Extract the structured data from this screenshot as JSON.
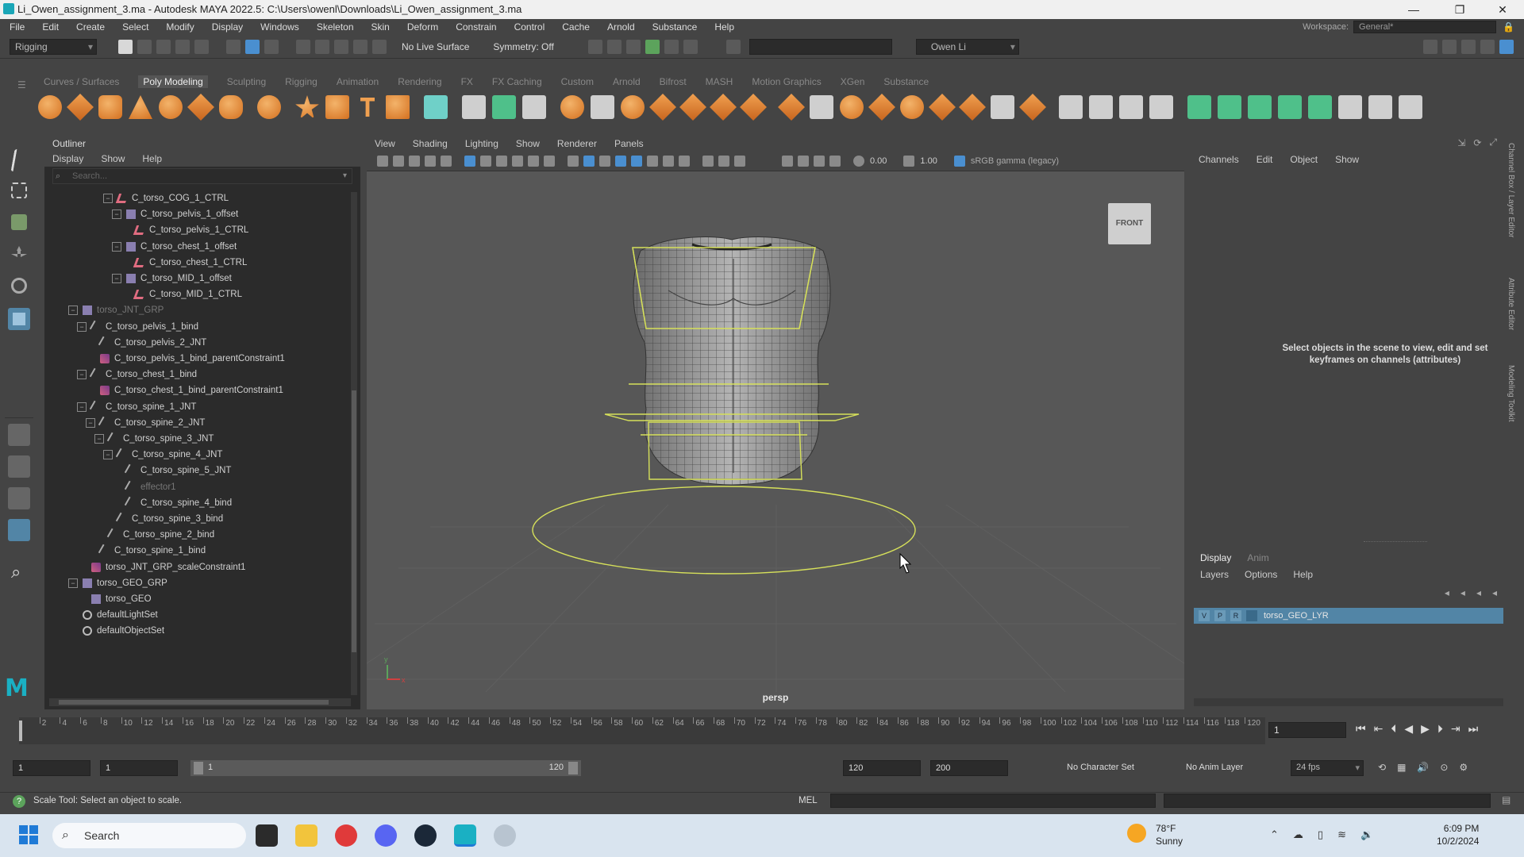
{
  "window": {
    "title": "Li_Owen_assignment_3.ma - Autodesk MAYA 2022.5: C:\\Users\\owenl\\Downloads\\Li_Owen_assignment_3.ma"
  },
  "menubar": {
    "items": [
      "File",
      "Edit",
      "Create",
      "Select",
      "Modify",
      "Display",
      "Windows",
      "Skeleton",
      "Skin",
      "Deform",
      "Constrain",
      "Control",
      "Cache",
      "Arnold",
      "Substance",
      "Help"
    ],
    "workspace_label": "Workspace:",
    "workspace_value": "General*"
  },
  "statusline": {
    "menuset": "Rigging",
    "live_surface": "No Live Surface",
    "symmetry": "Symmetry: Off",
    "user": "Owen Li"
  },
  "shelf": {
    "tabs": [
      "Curves / Surfaces",
      "Poly Modeling",
      "Sculpting",
      "Rigging",
      "Animation",
      "Rendering",
      "FX",
      "FX Caching",
      "Custom",
      "Arnold",
      "Bifrost",
      "MASH",
      "Motion Graphics",
      "XGen",
      "Substance"
    ],
    "active_tab": "Poly Modeling"
  },
  "outliner": {
    "title": "Outliner",
    "menu": [
      "Display",
      "Show",
      "Help"
    ],
    "search_placeholder": "Search...",
    "items": [
      {
        "label": "C_torso_COG_1_CTRL",
        "indent": 6,
        "icon": "ctrl",
        "toggle": "⊟"
      },
      {
        "label": "C_torso_pelvis_1_offset",
        "indent": 7,
        "icon": "grp",
        "toggle": "⊟"
      },
      {
        "label": "C_torso_pelvis_1_CTRL",
        "indent": 8,
        "icon": "ctrl",
        "toggle": ""
      },
      {
        "label": "C_torso_chest_1_offset",
        "indent": 7,
        "icon": "grp",
        "toggle": "⊟"
      },
      {
        "label": "C_torso_chest_1_CTRL",
        "indent": 8,
        "icon": "ctrl",
        "toggle": ""
      },
      {
        "label": "C_torso_MID_1_offset",
        "indent": 7,
        "icon": "grp",
        "toggle": "⊟"
      },
      {
        "label": "C_torso_MID_1_CTRL",
        "indent": 8,
        "icon": "ctrl",
        "toggle": ""
      },
      {
        "label": "torso_JNT_GRP",
        "indent": 2,
        "icon": "grp",
        "toggle": "⊟",
        "grey": true
      },
      {
        "label": "C_torso_pelvis_1_bind",
        "indent": 3,
        "icon": "jnt",
        "toggle": "⊟"
      },
      {
        "label": "C_torso_pelvis_2_JNT",
        "indent": 4,
        "icon": "jnt",
        "toggle": ""
      },
      {
        "label": "C_torso_pelvis_1_bind_parentConstraint1",
        "indent": 4,
        "icon": "con",
        "toggle": ""
      },
      {
        "label": "C_torso_chest_1_bind",
        "indent": 3,
        "icon": "jnt",
        "toggle": "⊟"
      },
      {
        "label": "C_torso_chest_1_bind_parentConstraint1",
        "indent": 4,
        "icon": "con",
        "toggle": ""
      },
      {
        "label": "C_torso_spine_1_JNT",
        "indent": 3,
        "icon": "jnt",
        "toggle": "⊟"
      },
      {
        "label": "C_torso_spine_2_JNT",
        "indent": 4,
        "icon": "jnt",
        "toggle": "⊟"
      },
      {
        "label": "C_torso_spine_3_JNT",
        "indent": 5,
        "icon": "jnt",
        "toggle": "⊟"
      },
      {
        "label": "C_torso_spine_4_JNT",
        "indent": 6,
        "icon": "jnt",
        "toggle": "⊟"
      },
      {
        "label": "C_torso_spine_5_JNT",
        "indent": 7,
        "icon": "jnt",
        "toggle": ""
      },
      {
        "label": "effector1",
        "indent": 7,
        "icon": "jnt",
        "toggle": "",
        "grey": true
      },
      {
        "label": "C_torso_spine_4_bind",
        "indent": 7,
        "icon": "jnt",
        "toggle": ""
      },
      {
        "label": "C_torso_spine_3_bind",
        "indent": 6,
        "icon": "jnt",
        "toggle": ""
      },
      {
        "label": "C_torso_spine_2_bind",
        "indent": 5,
        "icon": "jnt",
        "toggle": ""
      },
      {
        "label": "C_torso_spine_1_bind",
        "indent": 4,
        "icon": "jnt",
        "toggle": ""
      },
      {
        "label": "torso_JNT_GRP_scaleConstraint1",
        "indent": 3,
        "icon": "con",
        "toggle": ""
      },
      {
        "label": "torso_GEO_GRP",
        "indent": 2,
        "icon": "grp",
        "toggle": "⊟"
      },
      {
        "label": "torso_GEO",
        "indent": 3,
        "icon": "geo",
        "toggle": ""
      },
      {
        "label": "defaultLightSet",
        "indent": 2,
        "icon": "set",
        "toggle": ""
      },
      {
        "label": "defaultObjectSet",
        "indent": 2,
        "icon": "set",
        "toggle": ""
      }
    ]
  },
  "viewport": {
    "menu": [
      "View",
      "Shading",
      "Lighting",
      "Show",
      "Renderer",
      "Panels"
    ],
    "exposure": "0.00",
    "gamma": "1.00",
    "colorspace": "sRGB gamma (legacy)",
    "viewcube": "FRONT",
    "camera": "persp"
  },
  "channelbox": {
    "menu": [
      "Channels",
      "Edit",
      "Object",
      "Show"
    ],
    "empty_message": "Select objects in the scene to view, edit and set keyframes on channels (attributes)",
    "layer_tabs": [
      "Display",
      "Anim"
    ],
    "layer_menu": [
      "Layers",
      "Options",
      "Help"
    ],
    "layer": {
      "v": "V",
      "p": "P",
      "r": "R",
      "name": "torso_GEO_LYR"
    },
    "side_tabs": [
      "Channel Box / Layer Editor",
      "Attribute Editor",
      "Modeling Toolkit"
    ]
  },
  "timeslider": {
    "ticks": [
      2,
      4,
      6,
      8,
      10,
      12,
      14,
      16,
      18,
      20,
      22,
      24,
      26,
      28,
      30,
      32,
      34,
      36,
      38,
      40,
      42,
      44,
      46,
      48,
      50,
      52,
      54,
      56,
      58,
      60,
      62,
      64,
      66,
      68,
      70,
      72,
      74,
      76,
      78,
      80,
      82,
      84,
      86,
      88,
      90,
      92,
      94,
      96,
      98,
      100,
      102,
      104,
      106,
      108,
      110,
      112,
      114,
      116,
      118,
      120
    ],
    "current_frame": "1"
  },
  "rangeslider": {
    "start": "1",
    "anim_start": "1",
    "range_in": "1",
    "range_out": "120",
    "end": "120",
    "anim_end": "200",
    "character_set": "No Character Set",
    "anim_layer": "No Anim Layer",
    "fps": "24 fps"
  },
  "cmdline": {
    "help_text": "Scale Tool: Select an object to scale.",
    "language": "MEL"
  },
  "taskbar": {
    "search": "Search",
    "temp": "78°F",
    "weather": "Sunny",
    "time": "6:09 PM",
    "date": "10/2/2024"
  }
}
